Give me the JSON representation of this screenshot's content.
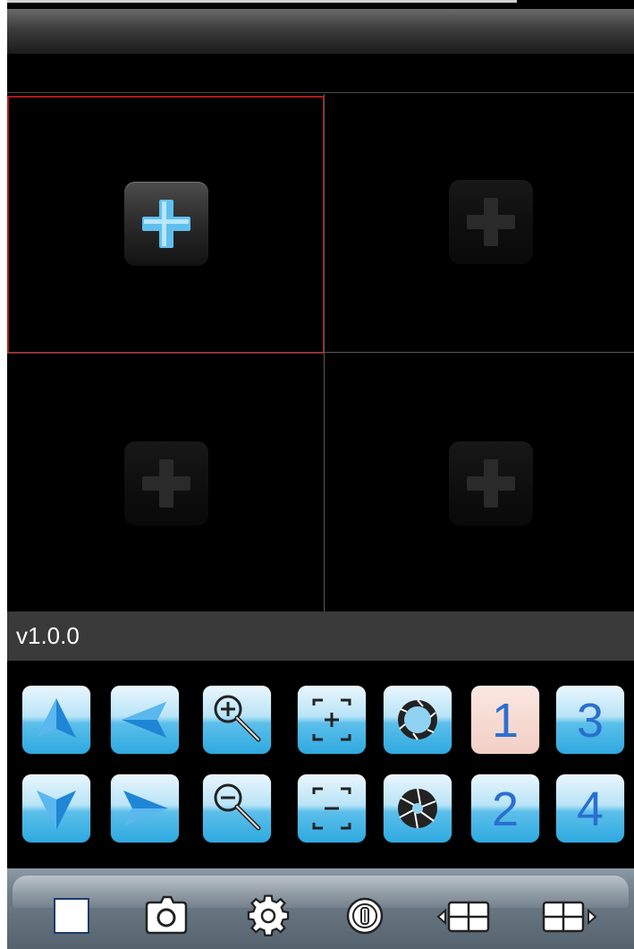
{
  "titlebar": {
    "title": ""
  },
  "grid": {
    "cells": [
      {
        "id": 1,
        "state": "selected",
        "icon": "add-camera-icon"
      },
      {
        "id": 2,
        "state": "empty",
        "icon": "add-camera-icon"
      },
      {
        "id": 3,
        "state": "empty",
        "icon": "add-camera-icon"
      },
      {
        "id": 4,
        "state": "empty",
        "icon": "add-camera-icon"
      }
    ],
    "selected_border_color": "#b01818"
  },
  "version": {
    "label": "v1.0.0"
  },
  "controls": {
    "row1": [
      {
        "name": "ptz-up",
        "icon": "arrow-up-icon"
      },
      {
        "name": "ptz-left",
        "icon": "arrow-left-icon"
      },
      {
        "name": "zoom-in",
        "icon": "zoom-in-icon"
      },
      {
        "name": "focus-near",
        "icon": "focus-plus-icon"
      },
      {
        "name": "iris-open",
        "icon": "iris-open-icon"
      },
      {
        "name": "preset-1",
        "label": "1",
        "selected": true
      },
      {
        "name": "preset-3",
        "label": "3"
      }
    ],
    "row2": [
      {
        "name": "ptz-down",
        "icon": "arrow-down-icon"
      },
      {
        "name": "ptz-right",
        "icon": "arrow-right-icon"
      },
      {
        "name": "zoom-out",
        "icon": "zoom-out-icon"
      },
      {
        "name": "focus-far",
        "icon": "focus-minus-icon"
      },
      {
        "name": "iris-close",
        "icon": "iris-close-icon"
      },
      {
        "name": "preset-2",
        "label": "2"
      },
      {
        "name": "preset-4",
        "label": "4"
      }
    ]
  },
  "toolbar": {
    "items": [
      {
        "name": "stop",
        "icon": "stop-square-icon"
      },
      {
        "name": "snapshot",
        "icon": "camera-icon"
      },
      {
        "name": "settings",
        "icon": "gear-icon"
      },
      {
        "name": "info",
        "icon": "info-icon"
      },
      {
        "name": "prev-page",
        "icon": "grid-prev-icon"
      },
      {
        "name": "next-page",
        "icon": "grid-next-icon"
      }
    ]
  },
  "colors": {
    "accent_blue": "#2ea9e0",
    "preset_selected_bg": "#f2cfc5",
    "toolbar_bg": "#6f7d89"
  }
}
